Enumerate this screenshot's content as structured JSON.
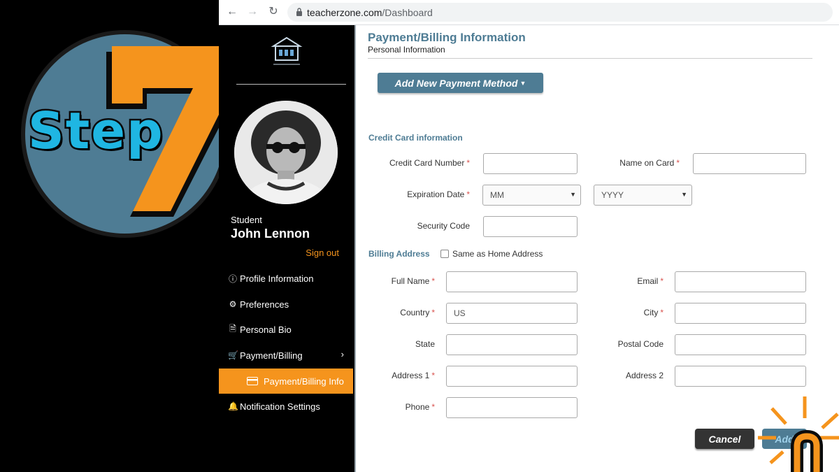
{
  "browser": {
    "url_domain": "teacherzone.com",
    "url_path": "/Dashboard"
  },
  "overlay": {
    "step_word": "Step",
    "step_number": "7",
    "colors": {
      "badge": "#4e7c94",
      "seven": "#f5941d",
      "step_text": "#1fb6e2"
    }
  },
  "sidebar": {
    "role": "Student",
    "user_name": "John Lennon",
    "sign_out": "Sign out",
    "items": [
      {
        "label": "Profile Information",
        "icon": "info-circle-icon"
      },
      {
        "label": "Preferences",
        "icon": "gears-icon"
      },
      {
        "label": "Personal Bio",
        "icon": "document-icon"
      },
      {
        "label": "Payment/Billing",
        "icon": "cart-icon"
      },
      {
        "label": "Payment/Billing Info",
        "icon": "credit-card-icon"
      },
      {
        "label": "Notification Settings",
        "icon": "bell-icon"
      }
    ]
  },
  "main": {
    "title": "Payment/Billing Information",
    "subtitle": "Personal Information",
    "add_method_button": "Add New Payment Method",
    "credit_section": "Credit Card information",
    "billing_section": "Billing Address",
    "same_as_home": "Same as Home Address",
    "fields": {
      "card_number": "Credit Card Number",
      "name_on_card": "Name on Card",
      "expiration": "Expiration Date",
      "exp_month": "MM",
      "exp_year": "YYYY",
      "security_code": "Security Code",
      "full_name": "Full Name",
      "email": "Email",
      "country": "Country",
      "country_value": "US",
      "city": "City",
      "state": "State",
      "postal_code": "Postal Code",
      "address1": "Address 1",
      "address2": "Address 2",
      "phone": "Phone"
    },
    "required_mark": "*",
    "cancel": "Cancel",
    "add": "Add"
  }
}
